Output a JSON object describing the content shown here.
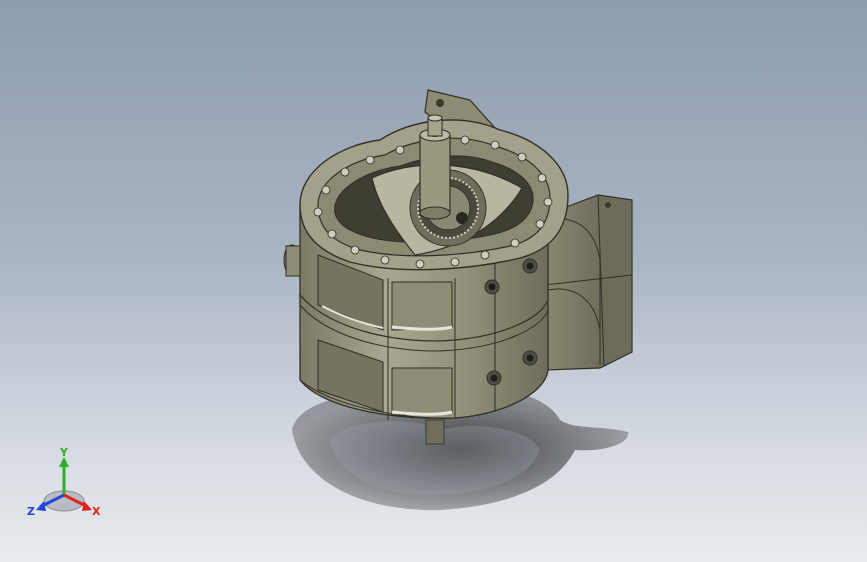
{
  "viewport": {
    "background_top": "#8e9cae",
    "background_bottom": "#e8ebee",
    "model_color": "#9c9a80",
    "shadow_color": "#2a2a2a"
  },
  "triad": {
    "x_label": "X",
    "y_label": "Y",
    "z_label": "Z",
    "x_color": "#e0241b",
    "y_color": "#2fae2a",
    "z_color": "#2545d8"
  }
}
